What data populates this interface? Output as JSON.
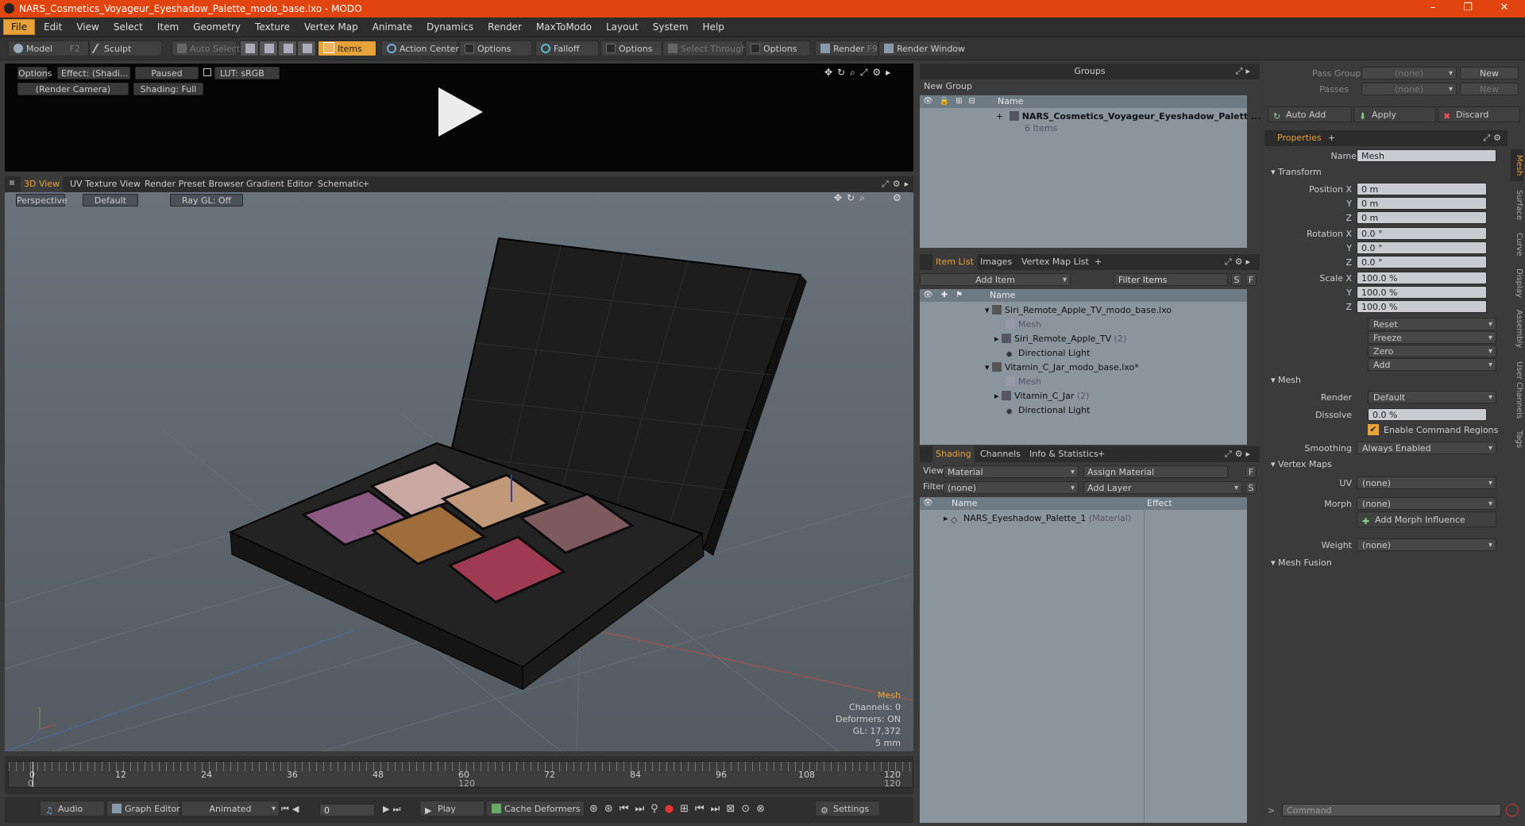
{
  "window": {
    "title": "NARS_Cosmetics_Voyageur_Eyeshadow_Palette_modo_base.lxo - MODO",
    "min": "–",
    "max": "❐",
    "close": "✕"
  },
  "menu": [
    "File",
    "Edit",
    "View",
    "Select",
    "Item",
    "Geometry",
    "Texture",
    "Vertex Map",
    "Animate",
    "Dynamics",
    "Render",
    "MaxToModo",
    "Layout",
    "System",
    "Help"
  ],
  "toolbar": {
    "model": "Model",
    "model_key": "F2",
    "sculpt": "Sculpt",
    "auto_select": "Auto Select",
    "items": "Items",
    "action_center": "Action Center",
    "options1": "Options",
    "falloff": "Falloff",
    "options2": "Options",
    "select_through": "Select Through",
    "options3": "Options",
    "render": "Render",
    "render_key": "F9",
    "render_window": "Render Window"
  },
  "preview": {
    "options": "Options",
    "effect": "Effect: (Shadi...",
    "paused": "Paused",
    "lut": "LUT: sRGB",
    "camera": "(Render Camera)",
    "shading": "Shading: Full"
  },
  "view_tabs": [
    "3D View",
    "UV Texture View",
    "Render Preset Browser",
    "Gradient Editor",
    "Schematic"
  ],
  "viewport": {
    "perspective": "Perspective",
    "default": "Default",
    "raygl": "Ray GL: Off",
    "info": {
      "type": "Mesh",
      "channels": "Channels: 0",
      "deformers": "Deformers: ON",
      "gl": "GL: 17,372",
      "scale": "5 mm"
    }
  },
  "timeline": {
    "ticks": [
      "0",
      "12",
      "24",
      "36",
      "48",
      "60",
      "72",
      "84",
      "96",
      "108",
      "120"
    ],
    "start": "0",
    "mid": "120",
    "end": "120"
  },
  "bottom_bar": {
    "audio": "Audio",
    "graph_editor": "Graph Editor",
    "animated": "Animated",
    "frame": "0",
    "play": "Play",
    "cache": "Cache Deformers",
    "settings": "Settings"
  },
  "groups": {
    "title": "Groups",
    "new_group": "New Group",
    "col_name": "Name",
    "item": "NARS_Cosmetics_Voyageur_Eyeshadow_Palett ...",
    "item_sub": "6 Items"
  },
  "item_list": {
    "tabs": [
      "Item List",
      "Images",
      "Vertex Map List"
    ],
    "add_item": "Add Item",
    "filter": "Filter Items",
    "col_name": "Name",
    "rows": [
      {
        "label": "Siri_Remote_Apple_TV_modo_base.lxo",
        "count": ""
      },
      {
        "label": "Mesh",
        "count": ""
      },
      {
        "label": "Siri_Remote_Apple_TV",
        "count": "(2)"
      },
      {
        "label": "Directional Light",
        "count": ""
      },
      {
        "label": "Vitamin_C_Jar_modo_base.lxo*",
        "count": ""
      },
      {
        "label": "Mesh",
        "count": ""
      },
      {
        "label": "Vitamin_C_Jar",
        "count": "(2)"
      },
      {
        "label": "Directional Light",
        "count": ""
      }
    ]
  },
  "shading": {
    "tabs": [
      "Shading",
      "Channels",
      "Info & Statistics"
    ],
    "view_label": "View",
    "view_value": "Material",
    "assign": "Assign Material",
    "filter_label": "Filter",
    "filter_value": "(none)",
    "add_layer": "Add Layer",
    "col_name": "Name",
    "col_effect": "Effect",
    "row": "NARS_Eyeshadow_Palette_1",
    "row_type": "(Material)"
  },
  "properties": {
    "pass_groups": "Pass Groups",
    "passes": "Passes",
    "none": "(none)",
    "new": "New",
    "auto_add": "Auto Add",
    "apply": "Apply",
    "discard": "Discard",
    "tab": "Properties",
    "name_label": "Name",
    "name_value": "Mesh",
    "transform": "Transform",
    "position_label": "Position X",
    "rotation_label": "Rotation X",
    "scale_label": "Scale X",
    "y": "Y",
    "z": "Z",
    "pos": [
      "0 m",
      "0 m",
      "0 m"
    ],
    "rot": [
      "0.0 °",
      "0.0 °",
      "0.0 °"
    ],
    "scl": [
      "100.0 %",
      "100.0 %",
      "100.0 %"
    ],
    "reset": "Reset",
    "freeze": "Freeze",
    "zero": "Zero",
    "add": "Add",
    "mesh": "Mesh",
    "render_label": "Render",
    "render_value": "Default",
    "dissolve_label": "Dissolve",
    "dissolve_value": "0.0 %",
    "enable_cmd": "Enable Command Regions",
    "smoothing_label": "Smoothing",
    "smoothing_value": "Always Enabled",
    "vertex_maps": "Vertex Maps",
    "uv_label": "UV",
    "morph_label": "Morph",
    "add_morph": "Add Morph Influence",
    "weight_label": "Weight",
    "mesh_fusion": "Mesh Fusion",
    "side_tabs": [
      "Mesh",
      "Surface",
      "Curve",
      "Display",
      "Assembly",
      "User Channels",
      "Tags"
    ],
    "command": "Command"
  }
}
